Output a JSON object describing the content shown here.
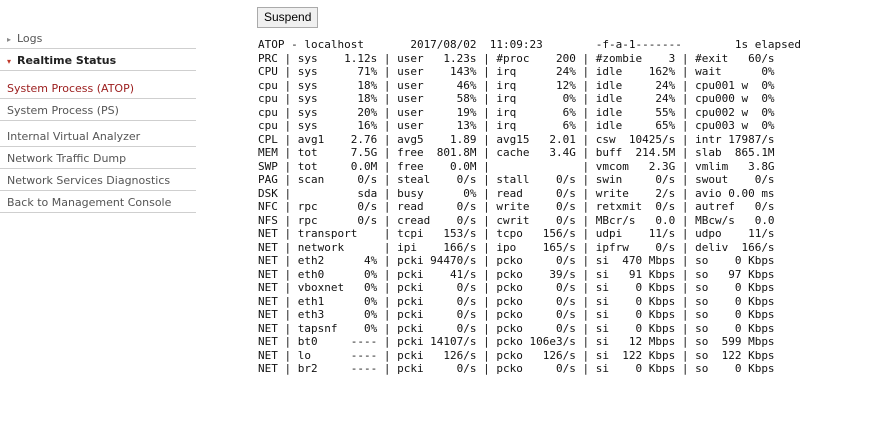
{
  "sidebar": {
    "items": [
      {
        "label": "Logs",
        "caret": "▸"
      },
      {
        "label": "Realtime Status",
        "caret": "▾"
      },
      {
        "label": "System Process (ATOP)"
      },
      {
        "label": "System Process (PS)"
      },
      {
        "label": "Internal Virtual Analyzer"
      },
      {
        "label": "Network Traffic Dump"
      },
      {
        "label": "Network Services Diagnostics"
      },
      {
        "label": "Back to Management Console"
      }
    ]
  },
  "toolbar": {
    "suspend_label": "Suspend"
  },
  "atop": {
    "lines": [
      "ATOP - localhost       2017/08/02  11:09:23        -f-a-1-------        1s elapsed",
      "PRC | sys    1.12s | user   1.23s | #proc    200 | #zombie    3 | #exit   60/s",
      "CPU | sys      71% | user    143% | irq      24% | idle    162% | wait      0%",
      "cpu | sys      18% | user     46% | irq      12% | idle     24% | cpu001 w  0%",
      "cpu | sys      18% | user     58% | irq       0% | idle     24% | cpu000 w  0%",
      "cpu | sys      20% | user     19% | irq       6% | idle     55% | cpu002 w  0%",
      "cpu | sys      16% | user     13% | irq       6% | idle     65% | cpu003 w  0%",
      "CPL | avg1    2.76 | avg5    1.89 | avg15   2.01 | csw  10425/s | intr 17987/s",
      "MEM | tot     7.5G | free  801.8M | cache   3.4G | buff  214.5M | slab  865.1M",
      "SWP | tot     0.0M | free    0.0M |              | vmcom   2.3G | vmlim   3.8G",
      "PAG | scan     0/s | steal    0/s | stall    0/s | swin     0/s | swout    0/s",
      "DSK |          sda | busy      0% | read     0/s | write    2/s | avio 0.00 ms",
      "NFC | rpc      0/s | read     0/s | write    0/s | retxmit  0/s | autref   0/s",
      "NFS | rpc      0/s | cread    0/s | cwrit    0/s | MBcr/s   0.0 | MBcw/s   0.0",
      "NET | transport    | tcpi   153/s | tcpo   156/s | udpi    11/s | udpo    11/s",
      "NET | network      | ipi    166/s | ipo    165/s | ipfrw    0/s | deliv  166/s",
      "NET | eth2      4% | pcki 94470/s | pcko     0/s | si  470 Mbps | so    0 Kbps",
      "NET | eth0      0% | pcki    41/s | pcko    39/s | si   91 Kbps | so   97 Kbps",
      "NET | vboxnet   0% | pcki     0/s | pcko     0/s | si    0 Kbps | so    0 Kbps",
      "NET | eth1      0% | pcki     0/s | pcko     0/s | si    0 Kbps | so    0 Kbps",
      "NET | eth3      0% | pcki     0/s | pcko     0/s | si    0 Kbps | so    0 Kbps",
      "NET | tapsnf    0% | pcki     0/s | pcko     0/s | si    0 Kbps | so    0 Kbps",
      "NET | bt0     ---- | pcki 14107/s | pcko 106e3/s | si   12 Mbps | so  599 Mbps",
      "NET | lo      ---- | pcki   126/s | pcko   126/s | si  122 Kbps | so  122 Kbps",
      "NET | br2     ---- | pcki     0/s | pcko     0/s | si    0 Kbps | so    0 Kbps"
    ]
  }
}
